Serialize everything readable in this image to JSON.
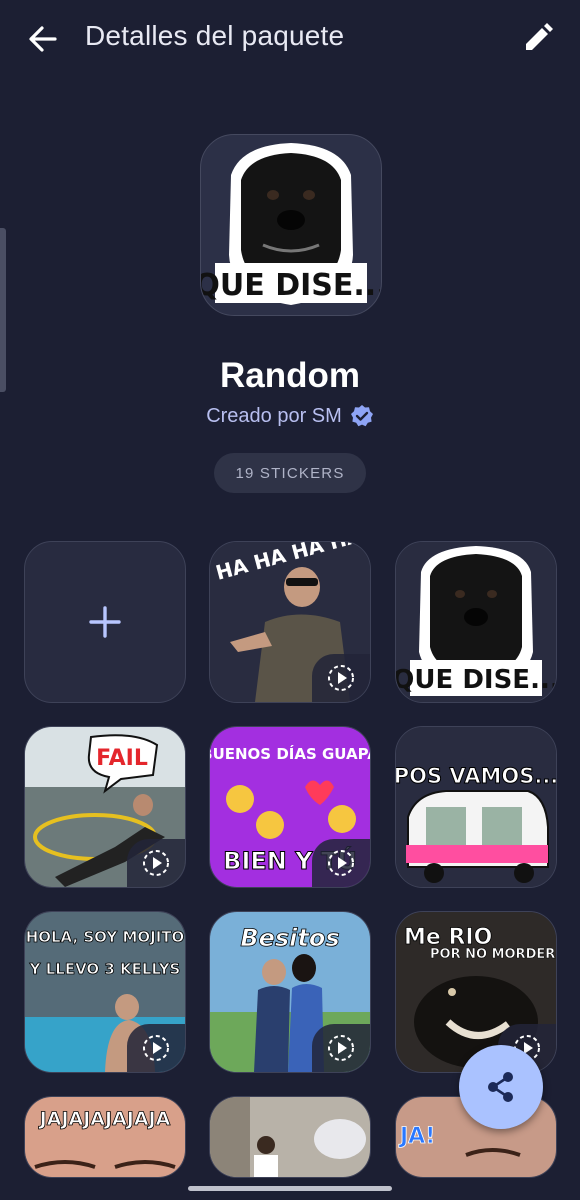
{
  "header": {
    "title": "Detalles del paquete",
    "back_icon": "arrow-back-icon",
    "edit_icon": "pencil-icon"
  },
  "pack": {
    "name": "Random",
    "creator": "Creado por SM",
    "verified_icon": "verified-badge-icon",
    "count_label": "19 STICKERS",
    "cover_caption": "QUE DISE..."
  },
  "add_tile": {
    "icon": "plus-icon"
  },
  "stickers": [
    {
      "caption": "HA HA HA HA HA",
      "animated": true
    },
    {
      "caption": "QUE DISE...",
      "animated": false
    },
    {
      "caption": "FAIL",
      "animated": true
    },
    {
      "caption_top": "BUENOS DÍAS GUAPA",
      "caption_bottom": "BIEN Y TÚ",
      "animated": true
    },
    {
      "caption": "POS VAMOS...",
      "animated": false
    },
    {
      "caption_top": "HOLA, SOY MOJITO",
      "caption_bottom": "Y LLEVO 3 KELLYS",
      "animated": true
    },
    {
      "caption": "Besitos",
      "animated": true
    },
    {
      "caption_top": "Me RIO",
      "caption_bottom": "POR NO MORDER",
      "animated": true
    },
    {
      "caption": "JAJAJAJAJAJA",
      "animated": false
    },
    {
      "caption": "",
      "animated": false
    },
    {
      "caption": "JA!",
      "animated": false
    }
  ],
  "fab": {
    "icon": "share-icon"
  },
  "colors": {
    "background": "#1c1f33",
    "accent": "#aac2ff",
    "verified": "#8ea4f5"
  }
}
